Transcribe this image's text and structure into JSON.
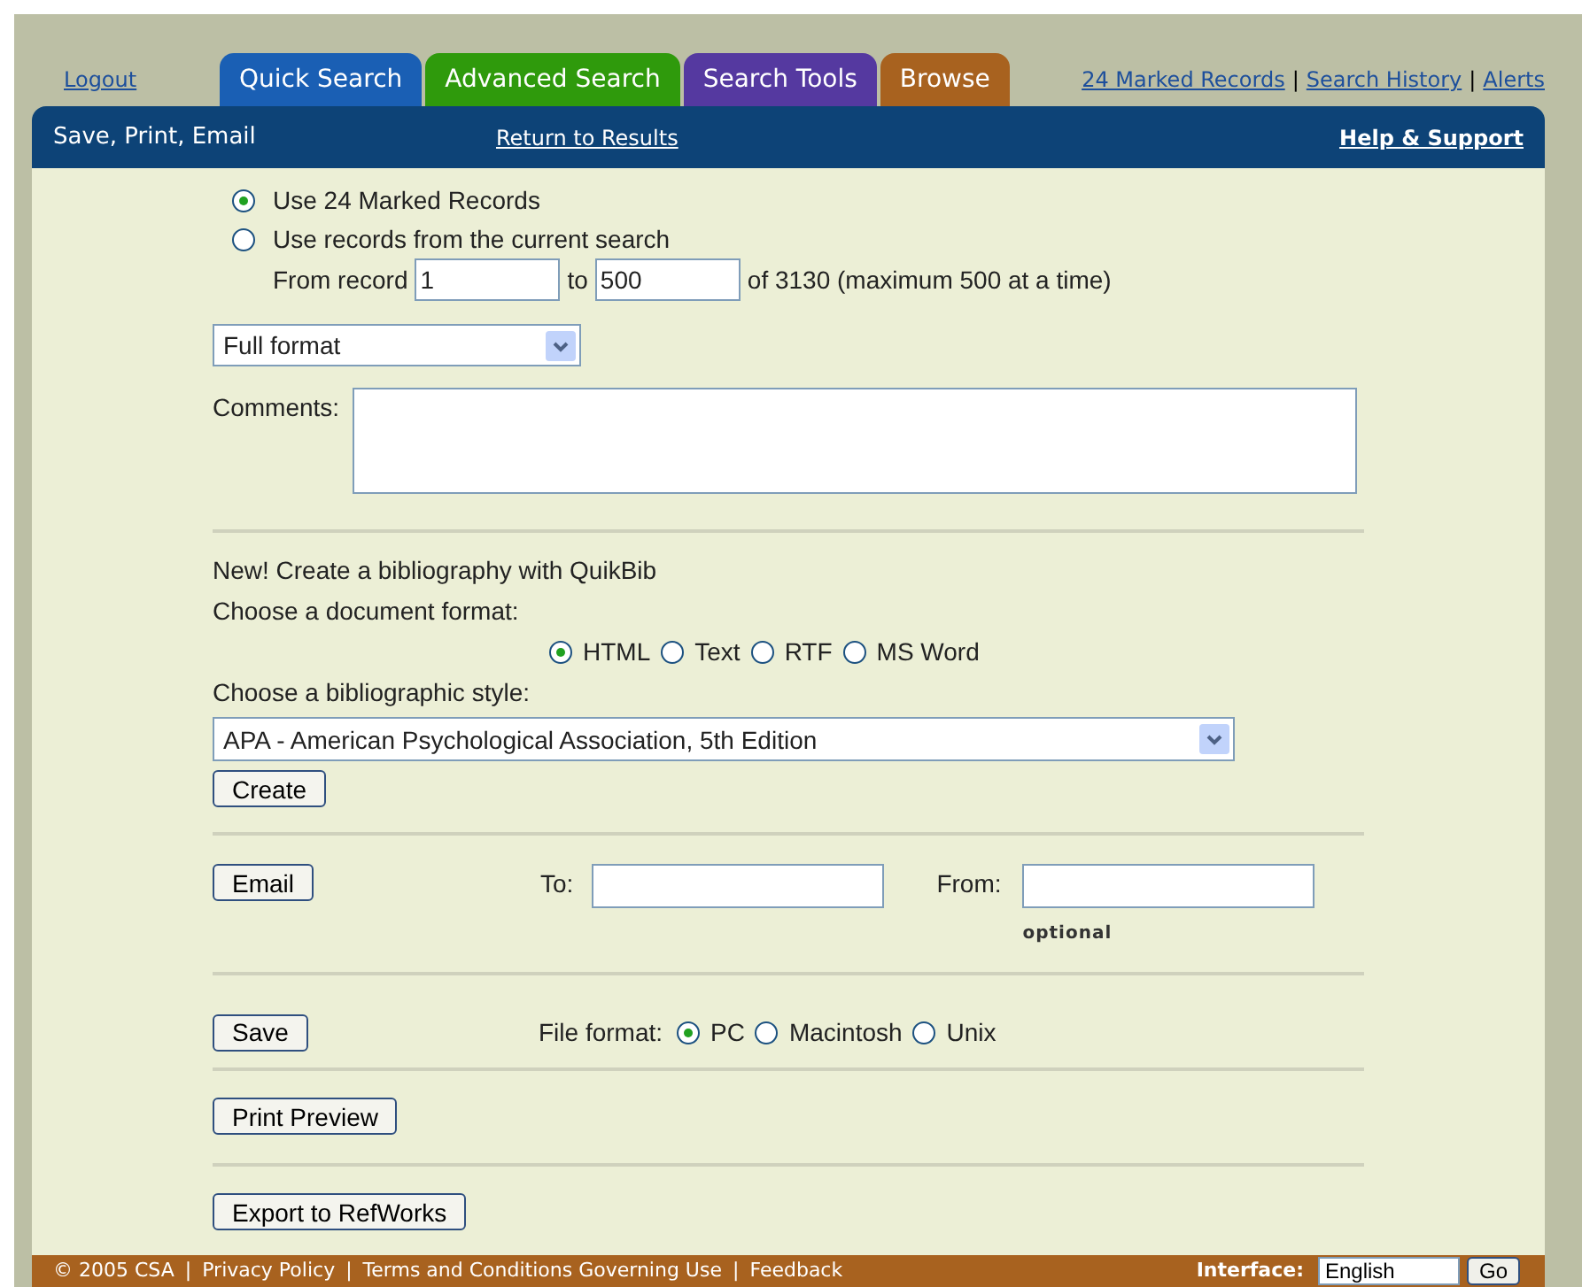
{
  "top_links": {
    "logout": "Logout",
    "right": [
      {
        "label": "24 Marked Records"
      },
      {
        "label": "Search History"
      },
      {
        "label": "Alerts"
      }
    ],
    "separator": "|"
  },
  "tabs": [
    {
      "label": "Quick Search",
      "color": "#1a5fb4"
    },
    {
      "label": "Advanced Search",
      "color": "#2f9a0c"
    },
    {
      "label": "Search Tools",
      "color": "#5539a0"
    },
    {
      "label": "Browse",
      "color": "#a8621f"
    }
  ],
  "header_bar": {
    "title": "Save, Print, Email",
    "return_link": "Return to Results",
    "help_link": "Help & Support"
  },
  "record_source": [
    {
      "label": "Use 24 Marked Records",
      "selected": true
    },
    {
      "label": "Use records from the current search",
      "selected": false
    }
  ],
  "range": {
    "from_label": "From record",
    "from_value": "1",
    "to_label": "to",
    "to_value": "500",
    "note": "of 3130 (maximum 500 at a time)"
  },
  "format_select": {
    "value": "Full format"
  },
  "comments": {
    "label": "Comments:"
  },
  "quikbib": {
    "heading": "New! Create a bibliography with QuikBib",
    "doc_format_label": "Choose a document format:",
    "doc_formats": [
      {
        "label": "HTML",
        "selected": true
      },
      {
        "label": "Text",
        "selected": false
      },
      {
        "label": "RTF",
        "selected": false
      },
      {
        "label": "MS Word",
        "selected": false
      }
    ],
    "style_label": "Choose a bibliographic style:",
    "style_value": "APA - American Psychological Association, 5th Edition",
    "create_button": "Create"
  },
  "email": {
    "button": "Email",
    "to_label": "To:",
    "from_label": "From:",
    "from_hint": "optional"
  },
  "save": {
    "button": "Save",
    "format_label": "File format:",
    "formats": [
      {
        "label": "PC",
        "selected": true
      },
      {
        "label": "Macintosh",
        "selected": false
      },
      {
        "label": "Unix",
        "selected": false
      }
    ]
  },
  "print_button": "Print Preview",
  "export_button": "Export to RefWorks",
  "footer": {
    "links": [
      {
        "label": "© 2005 CSA"
      },
      {
        "label": "Privacy Policy"
      },
      {
        "label": "Terms and Conditions Governing Use"
      },
      {
        "label": "Feedback"
      }
    ],
    "separator": "|",
    "interface_label": "Interface:",
    "language": "English",
    "go_button": "Go"
  }
}
